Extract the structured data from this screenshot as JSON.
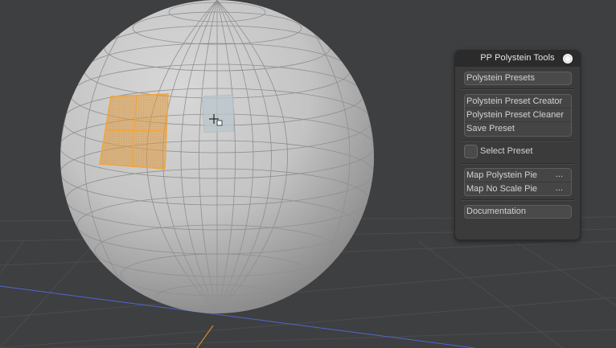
{
  "panel": {
    "title": "PP Polystein Tools",
    "presets_button": "Polystein Presets",
    "preset_group": [
      "Polystein Preset Creator",
      "Polystein Preset Cleaner",
      "Save Preset"
    ],
    "select_preset_label": "Select Preset",
    "select_preset_checked": false,
    "map_group": [
      {
        "label": "Map Polystein Pie",
        "suffix": "..."
      },
      {
        "label": "Map No Scale Pie",
        "suffix": "..."
      }
    ],
    "documentation_button": "Documentation"
  },
  "viewport": {
    "background_color": "#3d3f41",
    "sphere_color": "#c8c8c8",
    "selection_color": "#e39a3a",
    "hover_face_color": "#b9c6cc"
  }
}
